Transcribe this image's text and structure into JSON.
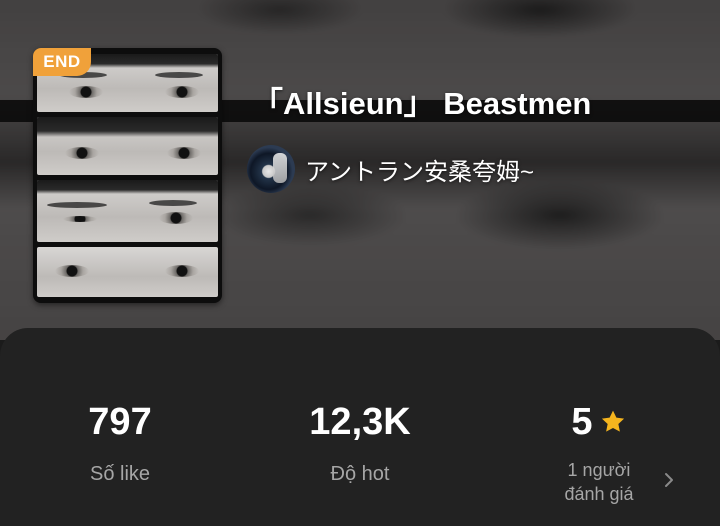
{
  "header": {
    "title": "「Allsieun」 Beastmen",
    "status_badge": "END",
    "author": "アントラン安桑夸姆~"
  },
  "stats": {
    "likes_value": "797",
    "likes_label": "Số like",
    "hot_value": "12,3K",
    "hot_label": "Độ hot",
    "rating_value": "5",
    "rating_count_line1": "1 người",
    "rating_count_line2": "đánh giá"
  },
  "colors": {
    "badge": "#f0a13a",
    "star": "#f5b51e",
    "panel": "#222222",
    "label": "#a6a6a6"
  },
  "icons": {
    "rating": "star-icon",
    "more": "chevron-right-icon"
  }
}
